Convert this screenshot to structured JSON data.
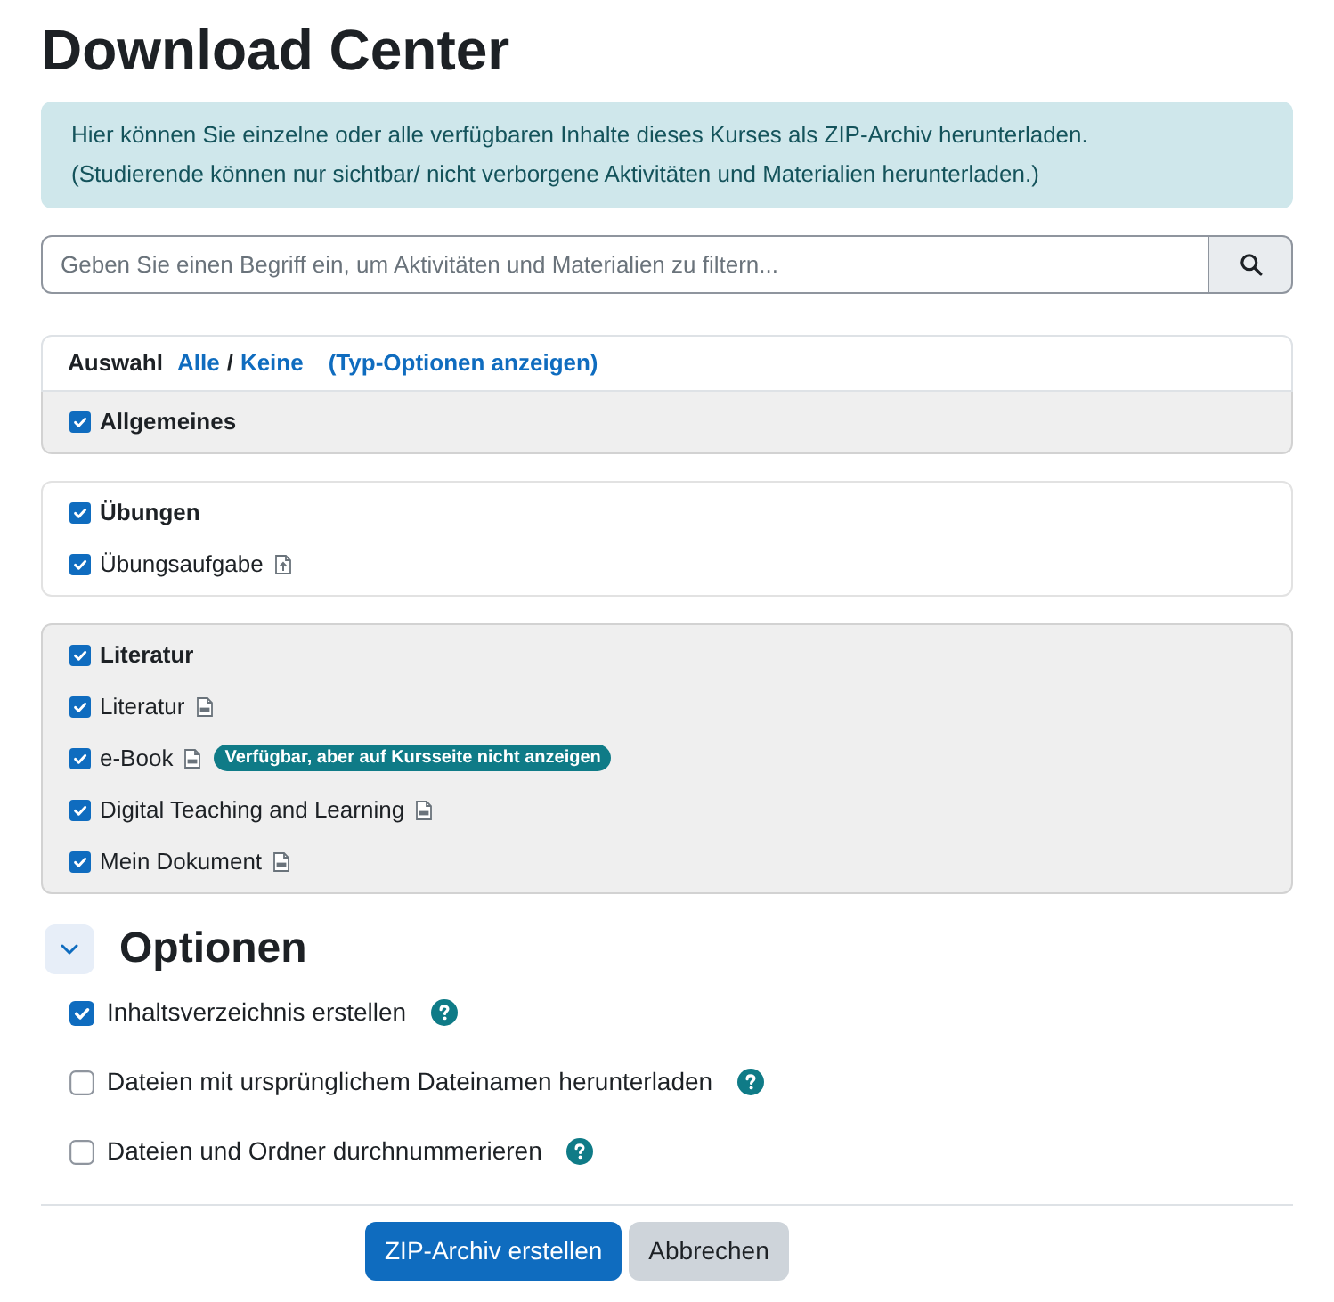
{
  "page_title": "Download Center",
  "info_box": {
    "lines": [
      "Hier können Sie einzelne oder alle verfügbaren Inhalte dieses Kurses als ZIP-Archiv herunterladen.",
      "(Studierende können nur sichtbar/ nicht verborgene Aktivitäten und Materialien herunterladen.)"
    ]
  },
  "search": {
    "placeholder": "Geben Sie einen Begriff ein, um Aktivitäten und Materialien zu filtern..."
  },
  "selection_bar": {
    "label": "Auswahl",
    "select_all": "Alle",
    "separator": "/",
    "select_none": "Keine",
    "type_options": "(Typ-Optionen anzeigen)"
  },
  "sections": [
    {
      "title": "Allgemeines",
      "checked": true,
      "highlighted": true
    },
    {
      "title": "Übungen",
      "checked": true,
      "highlighted": false,
      "items": [
        {
          "label": "Übungsaufgabe",
          "checked": true,
          "kind": "assignment"
        }
      ]
    },
    {
      "title": "Literatur",
      "checked": true,
      "highlighted": true,
      "items": [
        {
          "label": "Literatur",
          "checked": true,
          "kind": "file"
        },
        {
          "label": "e-Book",
          "checked": true,
          "kind": "file",
          "badge": "Verfügbar, aber auf Kursseite nicht anzeigen"
        },
        {
          "label": "Digital Teaching and Learning",
          "checked": true,
          "kind": "file"
        },
        {
          "label": "Mein Dokument",
          "checked": true,
          "kind": "file"
        }
      ]
    }
  ],
  "options": {
    "title": "Optionen",
    "expanded": true,
    "items": [
      {
        "label": "Inhaltsverzeichnis erstellen",
        "checked": true
      },
      {
        "label": "Dateien mit ursprünglichem Dateinamen herunterladen",
        "checked": false
      },
      {
        "label": "Dateien und Ordner durchnummerieren",
        "checked": false
      }
    ]
  },
  "buttons": [
    {
      "label": "ZIP-Archiv erstellen",
      "kind": "primary"
    },
    {
      "label": "Abbrechen",
      "kind": "secondary"
    }
  ]
}
